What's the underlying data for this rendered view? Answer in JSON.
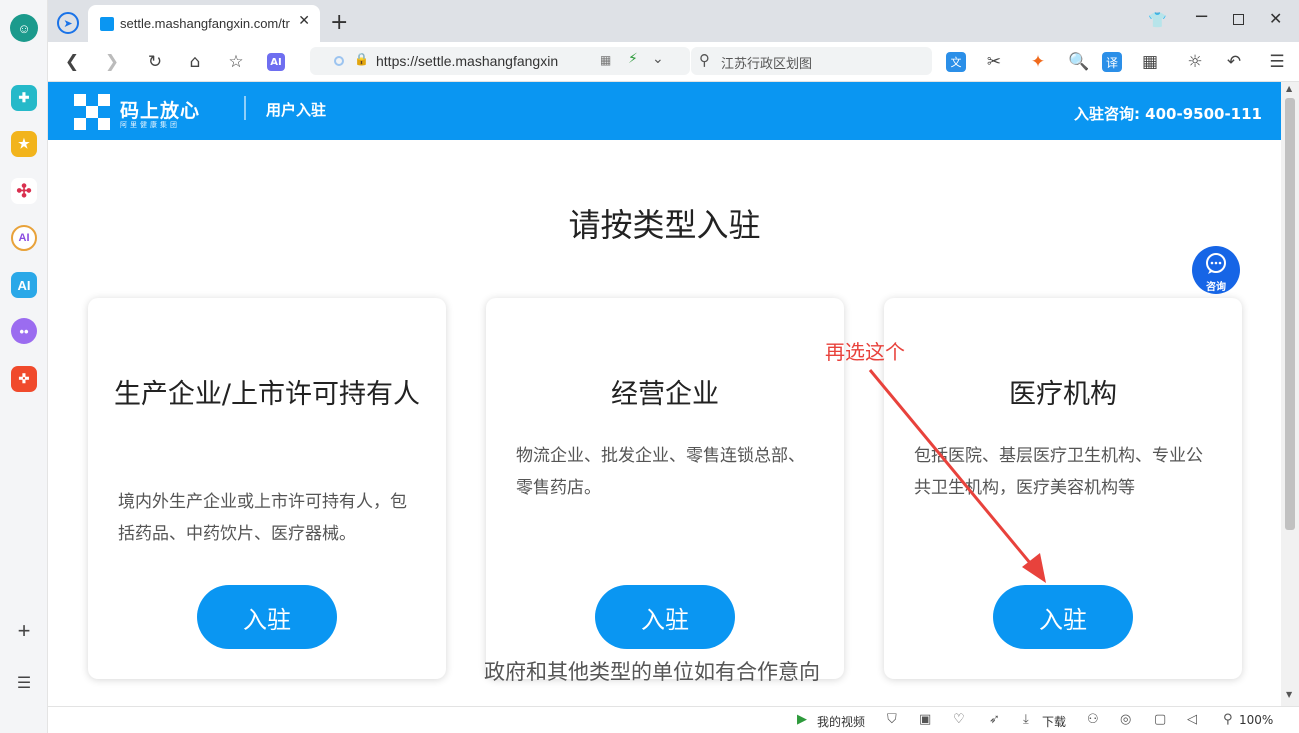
{
  "browser": {
    "tab_title": "settle.mashangfangxin.com/tr",
    "url": "https://settle.mashangfangxin",
    "search_placeholder": "江苏行政区划图",
    "status_video": "我的视频",
    "status_download": "下载",
    "zoom": "100%"
  },
  "header": {
    "logo_name": "码上放心",
    "logo_sub": "阿里健康集团",
    "title": "用户入驻",
    "phone": "入驻咨询: 400-9500-111"
  },
  "main": {
    "heading": "请按类型入驻",
    "cards": [
      {
        "title": "生产企业/上市许可持有人",
        "desc": "境内外生产企业或上市许可持有人，包括药品、中药饮片、医疗器械。",
        "button": "入驻"
      },
      {
        "title": "经营企业",
        "desc": "物流企业、批发企业、零售连锁总部、零售药店。",
        "button": "入驻"
      },
      {
        "title": "医疗机构",
        "desc": "包括医院、基层医疗卫生机构、专业公共卫生机构，医疗美容机构等",
        "button": "入驻"
      }
    ],
    "footer_text": "政府和其他类型的单位如有合作意向",
    "consult_label": "咨询"
  },
  "annotation": {
    "text": "再选这个",
    "color": "#e8423c"
  },
  "colors": {
    "brand_blue": "#0a96f2",
    "consult_blue": "#1665e6"
  }
}
